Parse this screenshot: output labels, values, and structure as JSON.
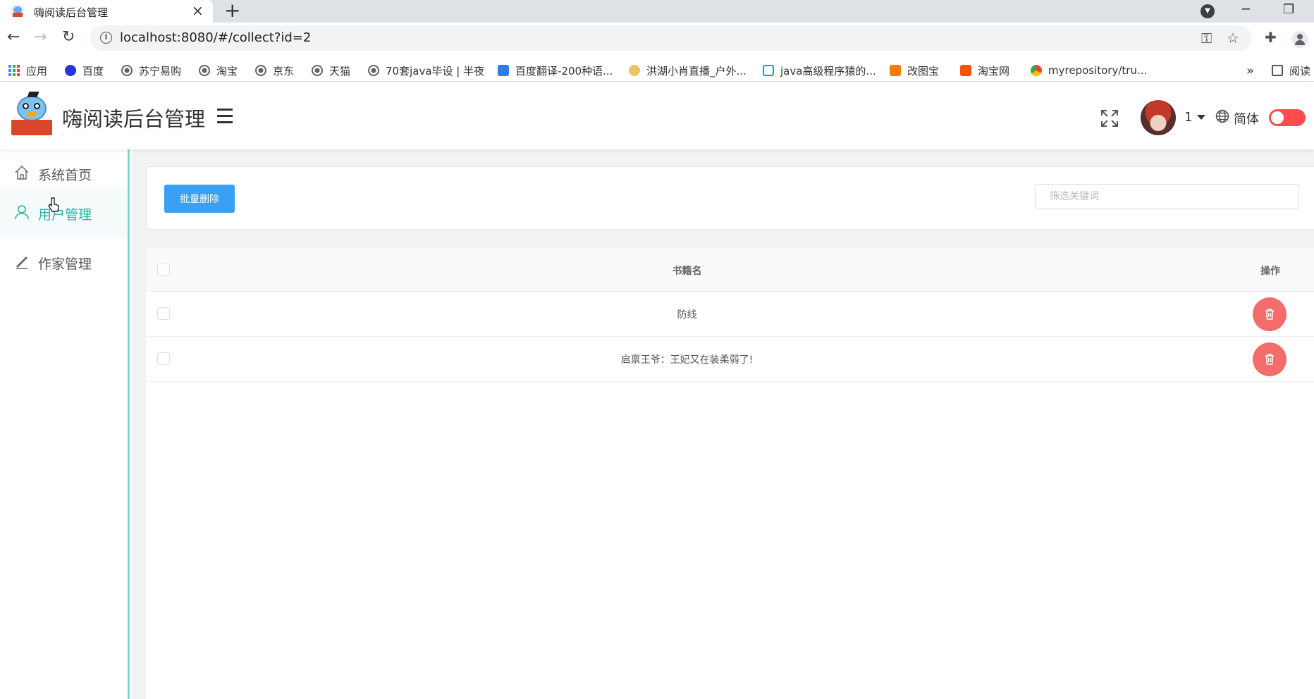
{
  "browser": {
    "tab_title": "嗨阅读后台管理",
    "tab_close": "×",
    "new_tab": "+",
    "url": "localhost:8080/#/collect?id=2",
    "bookmarks": [
      {
        "label": "应用",
        "icon": "apps-icon"
      },
      {
        "label": "百度",
        "icon": "baidu-paw-icon"
      },
      {
        "label": "苏宁易购",
        "icon": "globe-icon"
      },
      {
        "label": "淘宝",
        "icon": "globe-icon"
      },
      {
        "label": "京东",
        "icon": "globe-icon"
      },
      {
        "label": "天猫",
        "icon": "globe-icon"
      },
      {
        "label": "70套java毕设 | 半夜",
        "icon": "globe-icon"
      },
      {
        "label": "百度翻译-200种语...",
        "icon": "translate-icon"
      },
      {
        "label": "洪湖小肖直播_户外...",
        "icon": "bird-icon"
      },
      {
        "label": "java高级程序猿的...",
        "icon": "bilibili-icon"
      },
      {
        "label": "改图宝",
        "icon": "orange-square-icon"
      },
      {
        "label": "淘宝网",
        "icon": "taobao-icon"
      },
      {
        "label": "myrepository/tru...",
        "icon": "chrome-icon"
      },
      {
        "label": "阅读",
        "icon": "reading-list-icon"
      }
    ],
    "more_bookmarks": "»"
  },
  "header": {
    "app_title": "嗨阅读后台管理",
    "user_name": "1",
    "language": "简体"
  },
  "sidebar": {
    "items": [
      {
        "label": "系统首页",
        "icon": "home-icon",
        "active": false
      },
      {
        "label": "用户管理",
        "icon": "user-icon",
        "active": true
      },
      {
        "label": "作家管理",
        "icon": "pen-icon",
        "active": false
      }
    ]
  },
  "filter": {
    "batch_delete_label": "批量删除",
    "keyword_placeholder": "筛选关键词"
  },
  "table": {
    "columns": [
      "书籍名",
      "操作"
    ],
    "rows": [
      {
        "book_name": "防线"
      },
      {
        "book_name": "启禀王爷：王妃又在装柔弱了!"
      }
    ]
  },
  "colors": {
    "accent": "#30b0a8",
    "primary_button": "#3aa0f3",
    "danger": "#f56c6c",
    "toggle": "#ff4d4f"
  }
}
